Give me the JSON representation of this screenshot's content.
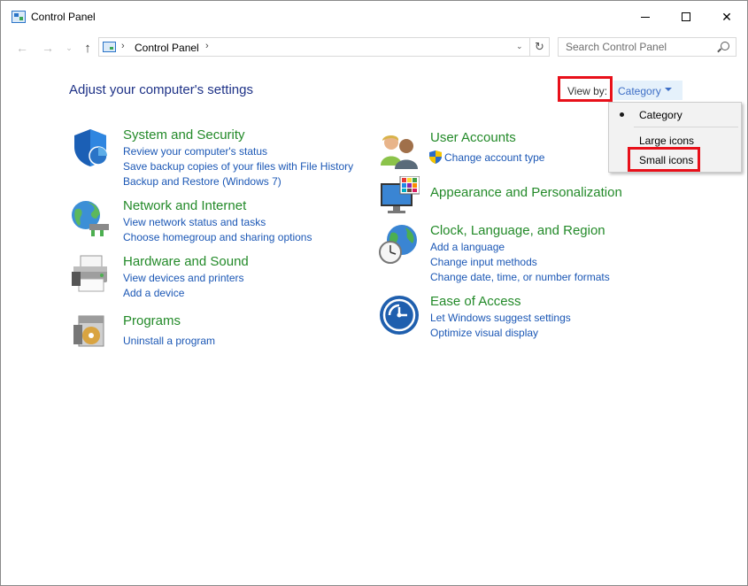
{
  "window": {
    "title": "Control Panel",
    "controls": {
      "minimize": "minimize",
      "maximize": "maximize",
      "close": "✕"
    }
  },
  "navigation": {
    "back": "←",
    "forward": "→",
    "recent": "⌄",
    "up": "↑",
    "address_path": "Control Panel",
    "refresh": "↻",
    "search_placeholder": "Search Control Panel"
  },
  "main": {
    "heading": "Adjust your computer's settings",
    "view_by": {
      "label": "View by:",
      "selected": "Category",
      "options": [
        "Category",
        "Large icons",
        "Small icons"
      ]
    },
    "categories_left": [
      {
        "title": "System and Security",
        "icon": "shield-icon",
        "links": [
          "Review your computer's status",
          "Save backup copies of your files with File History",
          "Backup and Restore (Windows 7)"
        ]
      },
      {
        "title": "Network and Internet",
        "icon": "globe-network-icon",
        "links": [
          "View network status and tasks",
          "Choose homegroup and sharing options"
        ]
      },
      {
        "title": "Hardware and Sound",
        "icon": "printer-icon",
        "links": [
          "View devices and printers",
          "Add a device"
        ]
      },
      {
        "title": "Programs",
        "icon": "programs-icon",
        "links": [
          "Uninstall a program"
        ]
      }
    ],
    "categories_right": [
      {
        "title": "User Accounts",
        "icon": "users-icon",
        "links": [
          "Change account type"
        ]
      },
      {
        "title": "Appearance and Personalization",
        "icon": "monitor-palette-icon",
        "links": []
      },
      {
        "title": "Clock, Language, and Region",
        "icon": "clock-globe-icon",
        "links": [
          "Add a language",
          "Change input methods",
          "Change date, time, or number formats"
        ]
      },
      {
        "title": "Ease of Access",
        "icon": "ease-of-access-icon",
        "links": [
          "Let Windows suggest settings",
          "Optimize visual display"
        ]
      }
    ]
  },
  "colors": {
    "category_title": "#238a29",
    "link": "#1b57b5",
    "heading": "#1e3287",
    "highlight": "#e8101a"
  }
}
